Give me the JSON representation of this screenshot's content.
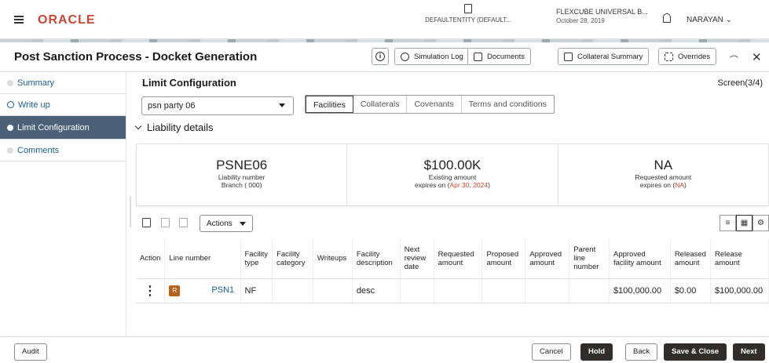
{
  "header": {
    "logo": "ORACLE",
    "entity": "DEFAULTENTITY (DEFAULT...",
    "branch_name": "FLEXCUBE UNIVERSAL B...",
    "branch_date": "October 28, 2019",
    "user": "NARAYAN"
  },
  "titlebar": {
    "title": "Post Sanction Process - Docket Generation",
    "simulation_log": "Simulation Log",
    "documents": "Documents",
    "collateral_summary": "Collateral Summary",
    "overrides": "Overrides"
  },
  "sidebar": {
    "items": [
      {
        "label": "Summary"
      },
      {
        "label": "Write up"
      },
      {
        "label": "Limit Configuration"
      },
      {
        "label": "Comments"
      }
    ]
  },
  "main": {
    "section_title": "Limit Configuration",
    "screen_count": "Screen(3/4)",
    "party_select": "psn party 06",
    "tabs": [
      "Facilities",
      "Collaterals",
      "Covenants",
      "Terms and conditions"
    ],
    "liability_header": "Liability details",
    "cards": [
      {
        "big": "PSNE06",
        "line1": "Liability number",
        "line2": "Branch ( 000)"
      },
      {
        "big": "$100.00K",
        "line1": "Existing amount",
        "line2_prefix": "expires on (",
        "line2_red": "Apr 30, 2024",
        "line2_suffix": ")"
      },
      {
        "big": "NA",
        "line1": "Requested amount",
        "line2_prefix": "expires on (",
        "line2_red": "NA",
        "line2_suffix": ")"
      }
    ],
    "actions_label": "Actions",
    "table": {
      "headers": [
        "Action",
        "Line number",
        "Facility type",
        "Facility category",
        "Writeups",
        "Facility description",
        "Next review date",
        "Requested amount",
        "Proposed amount",
        "Approved amount",
        "Parent line number",
        "Approved facility amount",
        "Released amount",
        "Release amount"
      ],
      "rows": [
        {
          "badge": "R",
          "line_number": "PSN1",
          "facility_type": "NF",
          "facility_category": "",
          "writeups": "",
          "facility_description": "desc",
          "next_review_date": "",
          "requested_amount": "",
          "proposed_amount": "",
          "approved_amount": "",
          "parent_line_number": "",
          "approved_facility_amount": "$100,000.00",
          "released_amount": "$0.00",
          "release_amount": "$100,000.00"
        }
      ]
    }
  },
  "footer": {
    "audit": "Audit",
    "cancel": "Cancel",
    "hold": "Hold",
    "back": "Back",
    "save_close": "Save & Close",
    "next": "Next"
  }
}
